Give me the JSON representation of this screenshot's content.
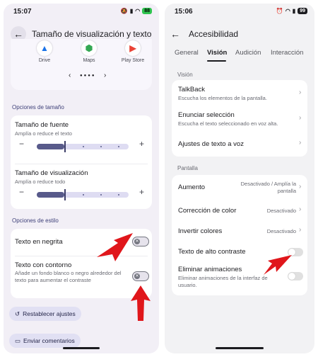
{
  "left": {
    "status": {
      "time": "15:07",
      "battery": "88"
    },
    "header": {
      "title": "Tamaño de visualización y texto"
    },
    "apps": [
      {
        "label": "Drive",
        "icon": "drive-icon",
        "color": "#1a73e8"
      },
      {
        "label": "Maps",
        "icon": "maps-icon",
        "color": "#34a853"
      },
      {
        "label": "Play Store",
        "icon": "play-store-icon",
        "color": "#ea4335"
      }
    ],
    "size_section": "Opciones de tamaño",
    "font_size": {
      "title": "Tamaño de fuente",
      "subtitle": "Amplía o reduce el texto",
      "level": 0.3
    },
    "display_size": {
      "title": "Tamaño de visualización",
      "subtitle": "Amplía o reduce todo",
      "level": 0.3
    },
    "style_section": "Opciones de estilo",
    "bold_text": {
      "title": "Texto en negrita",
      "enabled": false
    },
    "outline_text": {
      "title": "Texto con contorno",
      "subtitle": "Añade un fondo blanco o negro alrededor del texto para aumentar el contraste",
      "enabled": false
    },
    "reset_button": "Restablecer ajustes",
    "feedback_button": "Enviar comentarios",
    "accent": "#585a8a"
  },
  "right": {
    "status": {
      "time": "15:06",
      "battery": "99"
    },
    "header": {
      "title": "Accesibilidad"
    },
    "tabs": [
      {
        "label": "General",
        "active": false
      },
      {
        "label": "Visión",
        "active": true
      },
      {
        "label": "Audición",
        "active": false
      },
      {
        "label": "Interacción",
        "active": false
      }
    ],
    "vision_section": "Visión",
    "vision_items": [
      {
        "title": "TalkBack",
        "subtitle": "Escucha los elementos de la pantalla."
      },
      {
        "title": "Enunciar selección",
        "subtitle": "Escucha el texto seleccionado en voz alta."
      },
      {
        "title": "Ajustes de texto a voz",
        "subtitle": ""
      }
    ],
    "screen_section": "Pantalla",
    "screen_items": [
      {
        "title": "Aumento",
        "value": "Desactivado / Amplía la pantalla"
      },
      {
        "title": "Corrección de color",
        "value": "Desactivado"
      },
      {
        "title": "Invertir colores",
        "value": "Desactivado"
      },
      {
        "title": "Texto de alto contraste",
        "enabled": false
      },
      {
        "title": "Eliminar animaciones",
        "subtitle": "Eliminar animaciones de la interfaz de usuario.",
        "enabled": false
      }
    ]
  },
  "arrow_color": "#e0161b"
}
